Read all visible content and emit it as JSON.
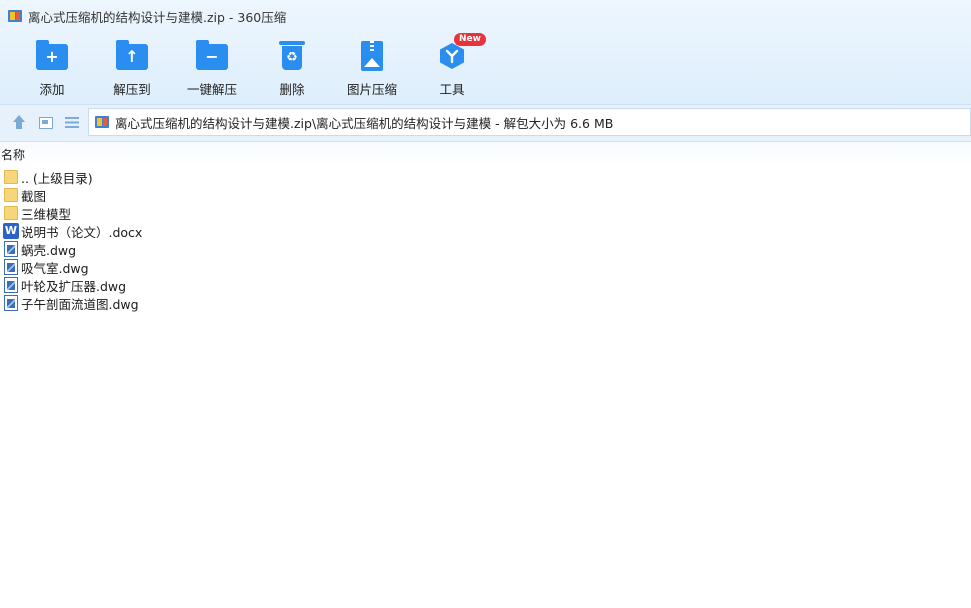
{
  "window": {
    "title": "离心式压缩机的结构设计与建模.zip - 360压缩"
  },
  "toolbar": {
    "items": [
      {
        "label": "添加",
        "icon": "add-folder-icon",
        "glyph": "+"
      },
      {
        "label": "解压到",
        "icon": "extract-to-icon",
        "glyph": "↑"
      },
      {
        "label": "一键解压",
        "icon": "one-click-extract-icon",
        "glyph": "−"
      },
      {
        "label": "删除",
        "icon": "delete-icon",
        "glyph": "♻"
      },
      {
        "label": "图片压缩",
        "icon": "image-compress-icon",
        "glyph": ""
      },
      {
        "label": "工具",
        "icon": "tools-icon",
        "glyph": "Y"
      }
    ],
    "new_badge": "New"
  },
  "nav": {
    "path": "离心式压缩机的结构设计与建模.zip\\离心式压缩机的结构设计与建模 - 解包大小为 6.6 MB"
  },
  "list": {
    "header_name": "名称",
    "files": [
      {
        "name": ".. (上级目录)",
        "type": "folder",
        "icon": "folder-icon"
      },
      {
        "name": "截图",
        "type": "folder",
        "icon": "folder-icon"
      },
      {
        "name": "三维模型",
        "type": "folder",
        "icon": "folder-icon"
      },
      {
        "name": "说明书（论文）.docx",
        "type": "docx",
        "icon": "word-doc-icon"
      },
      {
        "name": "蜗壳.dwg",
        "type": "dwg",
        "icon": "dwg-file-icon"
      },
      {
        "name": "吸气室.dwg",
        "type": "dwg",
        "icon": "dwg-file-icon"
      },
      {
        "name": "叶轮及扩压器.dwg",
        "type": "dwg",
        "icon": "dwg-file-icon"
      },
      {
        "name": "子午剖面流道图.dwg",
        "type": "dwg",
        "icon": "dwg-file-icon"
      }
    ]
  },
  "colors": {
    "accent": "#2a8df0",
    "badge": "#e8323c",
    "folder": "#f7d57a",
    "word": "#2b63c9"
  }
}
